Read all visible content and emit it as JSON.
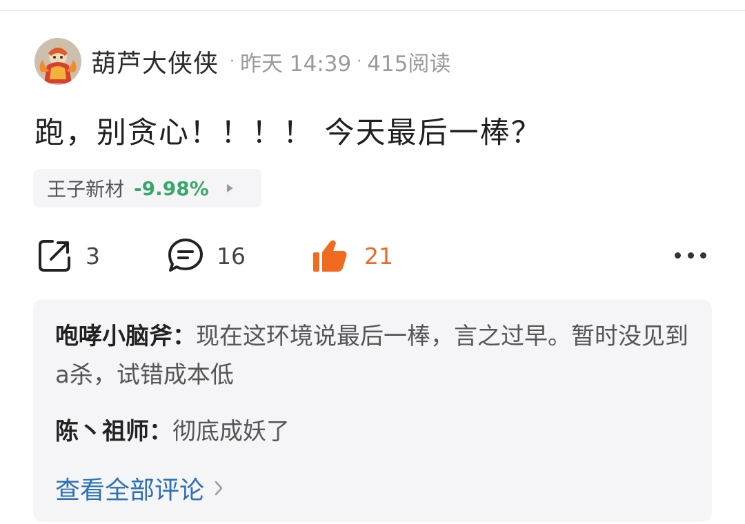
{
  "post": {
    "username": "葫芦大侠侠",
    "separator": "·",
    "time": "昨天 14:39",
    "reads": "415阅读",
    "text": "跑，别贪心！！！！ 今天最后一棒？"
  },
  "stock": {
    "name": "王子新材",
    "change": "-9.98%",
    "change_color": "#38a86a"
  },
  "actions": {
    "share_count": "3",
    "comment_count": "16",
    "like_count": "21",
    "like_color": "#f06a1f",
    "icons": [
      "share-icon",
      "comment-icon",
      "thumbs-up-icon",
      "more-icon"
    ]
  },
  "comments": [
    {
      "author": "咆哮小脑斧",
      "colon": "：",
      "text": "现在这环境说最后一棒，言之过早。暂时没见到a杀，试错成本低"
    },
    {
      "author": "陈丶祖师",
      "colon": "：",
      "text": "彻底成妖了"
    }
  ],
  "view_all": {
    "label": "查看全部评论",
    "color": "#2c6fb7"
  }
}
